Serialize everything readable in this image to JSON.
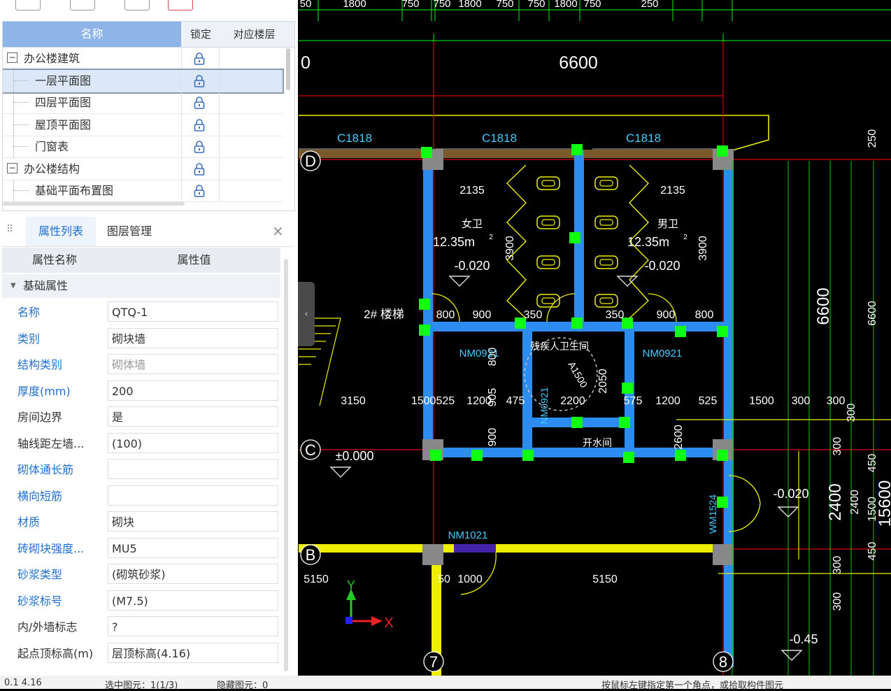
{
  "tree": {
    "headers": {
      "name": "名称",
      "lock": "锁定",
      "floor": "对应楼层"
    },
    "rows": [
      {
        "label": "办公楼建筑",
        "level": 0,
        "expand": "−"
      },
      {
        "label": "一层平面图",
        "level": 1,
        "selected": true
      },
      {
        "label": "四层平面图",
        "level": 1
      },
      {
        "label": "屋顶平面图",
        "level": 1
      },
      {
        "label": "门窗表",
        "level": 1
      },
      {
        "label": "办公楼结构",
        "level": 0,
        "expand": "−"
      },
      {
        "label": "基础平面布置图",
        "level": 1
      }
    ]
  },
  "panel": {
    "tab_props": "属性列表",
    "tab_layers": "图层管理",
    "col_name": "属性名称",
    "col_value": "属性值",
    "group": "基础属性",
    "rows": [
      {
        "k": "名称",
        "v": "QTQ-1",
        "blue": true
      },
      {
        "k": "类别",
        "v": "砌块墙",
        "blue": true
      },
      {
        "k": "结构类别",
        "v": "砌体墙",
        "blue": true,
        "vgrey": true
      },
      {
        "k": "厚度(mm)",
        "v": "200",
        "blue": true
      },
      {
        "k": "房间边界",
        "v": "是"
      },
      {
        "k": "轴线距左墙...",
        "v": "(100)"
      },
      {
        "k": "砌体通长筋",
        "v": "",
        "blue": true
      },
      {
        "k": "横向短筋",
        "v": "",
        "blue": true
      },
      {
        "k": "材质",
        "v": "砌块",
        "blue": true
      },
      {
        "k": "砖砌块强度...",
        "v": "MU5",
        "blue": true
      },
      {
        "k": "砂浆类型",
        "v": "(砌筑砂浆)",
        "blue": true
      },
      {
        "k": "砂浆标号",
        "v": "(M7.5)",
        "blue": true
      },
      {
        "k": "内/外墙标志",
        "v": "?"
      },
      {
        "k": "起点顶标高(m)",
        "v": "层顶标高(4.16)"
      }
    ]
  },
  "cad": {
    "top_dims": [
      "50",
      "1800",
      "750",
      "750",
      "1800",
      "750",
      "750",
      "1800",
      "750",
      "250"
    ],
    "overall_width": "6600",
    "left_zero": "0",
    "windows": [
      "C1818",
      "C1818",
      "C1818"
    ],
    "axes": {
      "D": "D",
      "C": "C",
      "B": "B",
      "n7": "7",
      "n8": "8"
    },
    "rooms": {
      "female": "女卫",
      "male": "男卫",
      "area": "12.35m",
      "sup": "2",
      "elev": "-0.020",
      "disabled": "残疾人卫生间",
      "water": "开水间",
      "stair": "2# 楼梯",
      "circle": "A1500"
    },
    "dims": {
      "d2135a": "2135",
      "d2135b": "2135",
      "d3900a": "3900",
      "d3900b": "3900",
      "d800a": "800",
      "d900a": "900",
      "d350a": "350",
      "d350b": "350",
      "d900b": "900",
      "d800b": "800",
      "d3150": "3150",
      "d1500_525": "1500525",
      "d1200a": "1200",
      "d905": "905",
      "d475": "475",
      "d2200": "2200",
      "d1200b": "1200",
      "d575": "575",
      "d525": "525",
      "d2050": "2050",
      "d800c": "800",
      "d900c": "900",
      "d2600": "2600",
      "d1500": "1500",
      "d300a": "300",
      "d300b": "300",
      "d5150a": "5150",
      "d50": "50",
      "d1000": "1000",
      "d5150b": "5150",
      "d6600v": "6600",
      "d6600s": "6600",
      "d2400": "2400",
      "d2400s": "2400",
      "d15600": "15600",
      "d250": "250",
      "d450a": "450",
      "d1500v": "1500",
      "d450b": "450",
      "d300c": "300",
      "d300d": "300",
      "d300e": "300",
      "d300f": "300"
    },
    "doors": {
      "nm0921a": "NM0921",
      "nm0921b": "NM0921",
      "nm0921v": "NM0921",
      "nm1021": "NM1021",
      "wm1524": "WM1524"
    },
    "levels": {
      "zero": "±0.000",
      "m002": "-0.020",
      "m045": "-0.45"
    },
    "axis_x": "X",
    "axis_y": "Y"
  },
  "status": {
    "left": "0.1  4.16",
    "mid": "选中图元：1(1/3)",
    "hide": "隐藏图元：0",
    "right": "按鼠标左键指定第一个角点，或拾取构件图元"
  }
}
